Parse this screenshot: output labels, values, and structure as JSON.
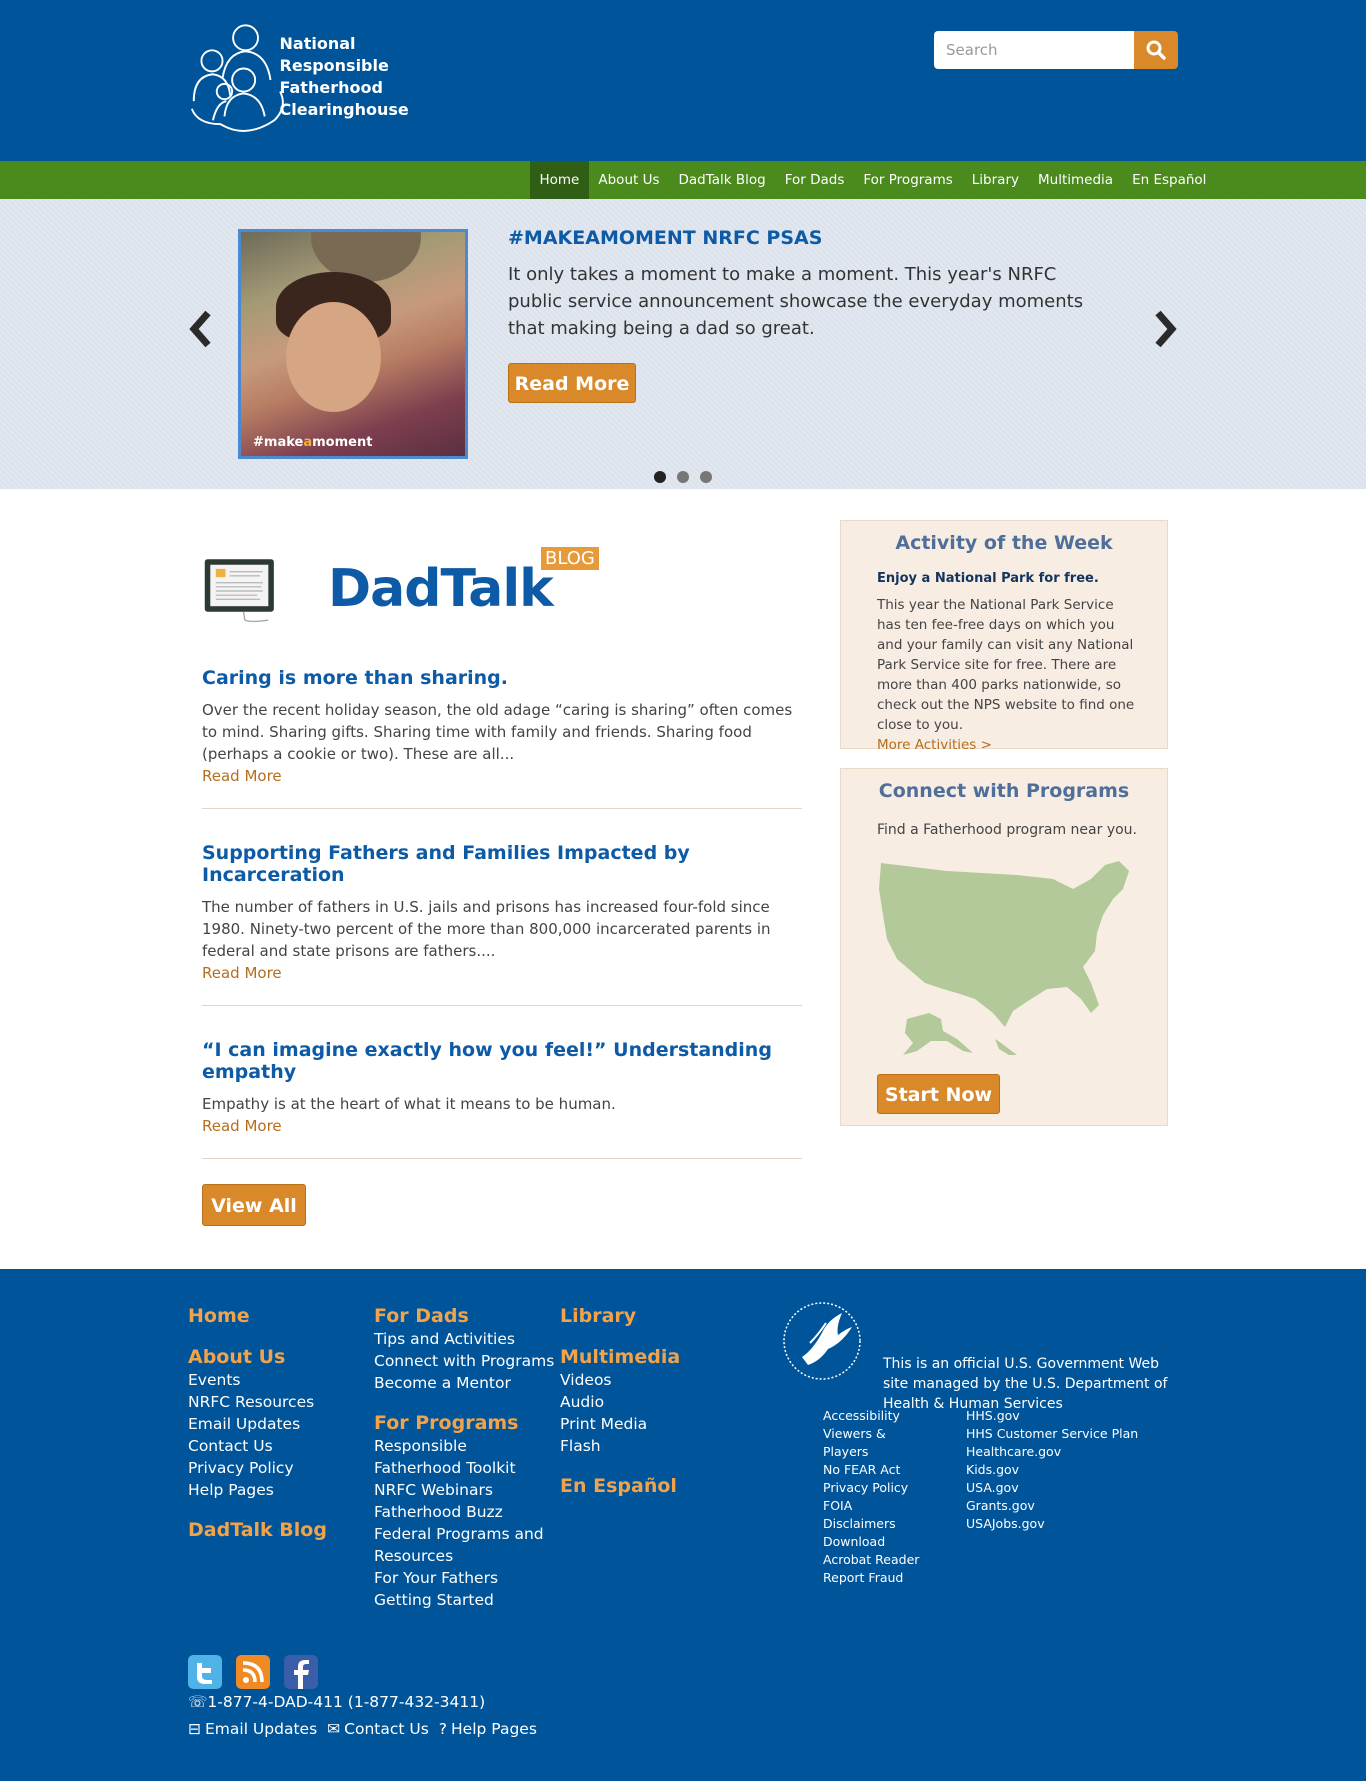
{
  "header": {
    "logo_lines": [
      "National",
      "Responsible",
      "Fatherhood Clearinghouse"
    ],
    "search_placeholder": "Search"
  },
  "nav": {
    "items": [
      "Home",
      "About Us",
      "DadTalk Blog",
      "For Dads",
      "For Programs",
      "Library",
      "Multimedia",
      "En Español"
    ],
    "active": "Home"
  },
  "carousel": {
    "title": "#MAKEAMOMENT NRFC PSAS",
    "body": "It only takes a moment to make a moment. This year's NRFC public service announcement showcase the everyday moments that making being a dad so great.",
    "read_more": "Read More",
    "photo_caption_pre": "#make",
    "photo_caption_a": "a",
    "photo_caption_post": "moment",
    "slide_count": 3,
    "active_slide": 1
  },
  "dadtalk": {
    "title": "DadTalk",
    "tag": "BLOG",
    "posts": [
      {
        "title": "Caring is more than sharing.",
        "body": "Over the recent holiday season, the old adage “caring is sharing” often comes to mind. Sharing gifts. Sharing time with family and friends. Sharing food (perhaps a cookie or two). These are all...",
        "more": "Read More"
      },
      {
        "title": "Supporting Fathers and Families Impacted by Incarceration",
        "body": "The number of fathers in U.S. jails and prisons has increased four-fold since 1980. Ninety-two percent of the more than 800,000 incarcerated parents in federal and state prisons are fathers....",
        "more": "Read More"
      },
      {
        "title": "“I can imagine exactly how you feel!” Understanding empathy",
        "body": "Empathy is at the heart of what it means to be human.",
        "more": "Read More"
      }
    ],
    "view_all": "View All"
  },
  "activity": {
    "title": "Activity of the Week",
    "subtitle": "Enjoy a National Park for free.",
    "body": "This year the National Park Service has ten fee-free days on which you and your family can visit any National Park Service site for free. There are more than 400 parks nationwide, so check out the NPS website to find one close to you.",
    "more": "More Activities >"
  },
  "programs": {
    "title": "Connect with Programs",
    "subtitle": "Find a Fatherhood program near you.",
    "button": "Start Now"
  },
  "footer": {
    "col1": {
      "home": "Home",
      "about": "About Us",
      "about_links": [
        "Events",
        "NRFC Resources",
        "Email Updates",
        "Contact Us",
        "Privacy Policy",
        "Help Pages"
      ],
      "blog": "DadTalk Blog"
    },
    "col2": {
      "dads": "For Dads",
      "dads_links": [
        "Tips and Activities",
        "Connect with Programs",
        "Become a Mentor"
      ],
      "programs": "For Programs",
      "programs_links": [
        "Responsible Fatherhood Toolkit",
        "NRFC Webinars",
        "Fatherhood Buzz",
        "Federal Programs and Resources",
        "For Your Fathers",
        "Getting Started"
      ]
    },
    "col3": {
      "library": "Library",
      "multimedia": "Multimedia",
      "multimedia_links": [
        "Videos",
        "Audio",
        "Print Media",
        "Flash"
      ],
      "espanol": "En Español"
    },
    "gov_text": "This is an official U.S. Government Web site managed by the U.S. Department of Health & Human Services",
    "gov_links_left": [
      "Accessibility",
      "Viewers & Players",
      "No FEAR Act",
      "Privacy Policy",
      "FOIA",
      "Disclaimers",
      "Download Acrobat Reader",
      "Report Fraud"
    ],
    "gov_links_right": [
      "HHS.gov",
      "HHS Customer Service Plan",
      "Healthcare.gov",
      "Kids.gov",
      "USA.gov",
      "Grants.gov",
      "USAJobs.gov"
    ],
    "phone": "1-877-4-DAD-411 (1-877-432-3411)",
    "bottom_links": [
      "Email Updates",
      "Contact Us",
      "Help Pages"
    ]
  },
  "colors": {
    "brand_blue": "#00549a",
    "nav_green": "#4b8a1d",
    "accent_orange": "#d9892a",
    "title_blue": "#0d5aa6"
  }
}
